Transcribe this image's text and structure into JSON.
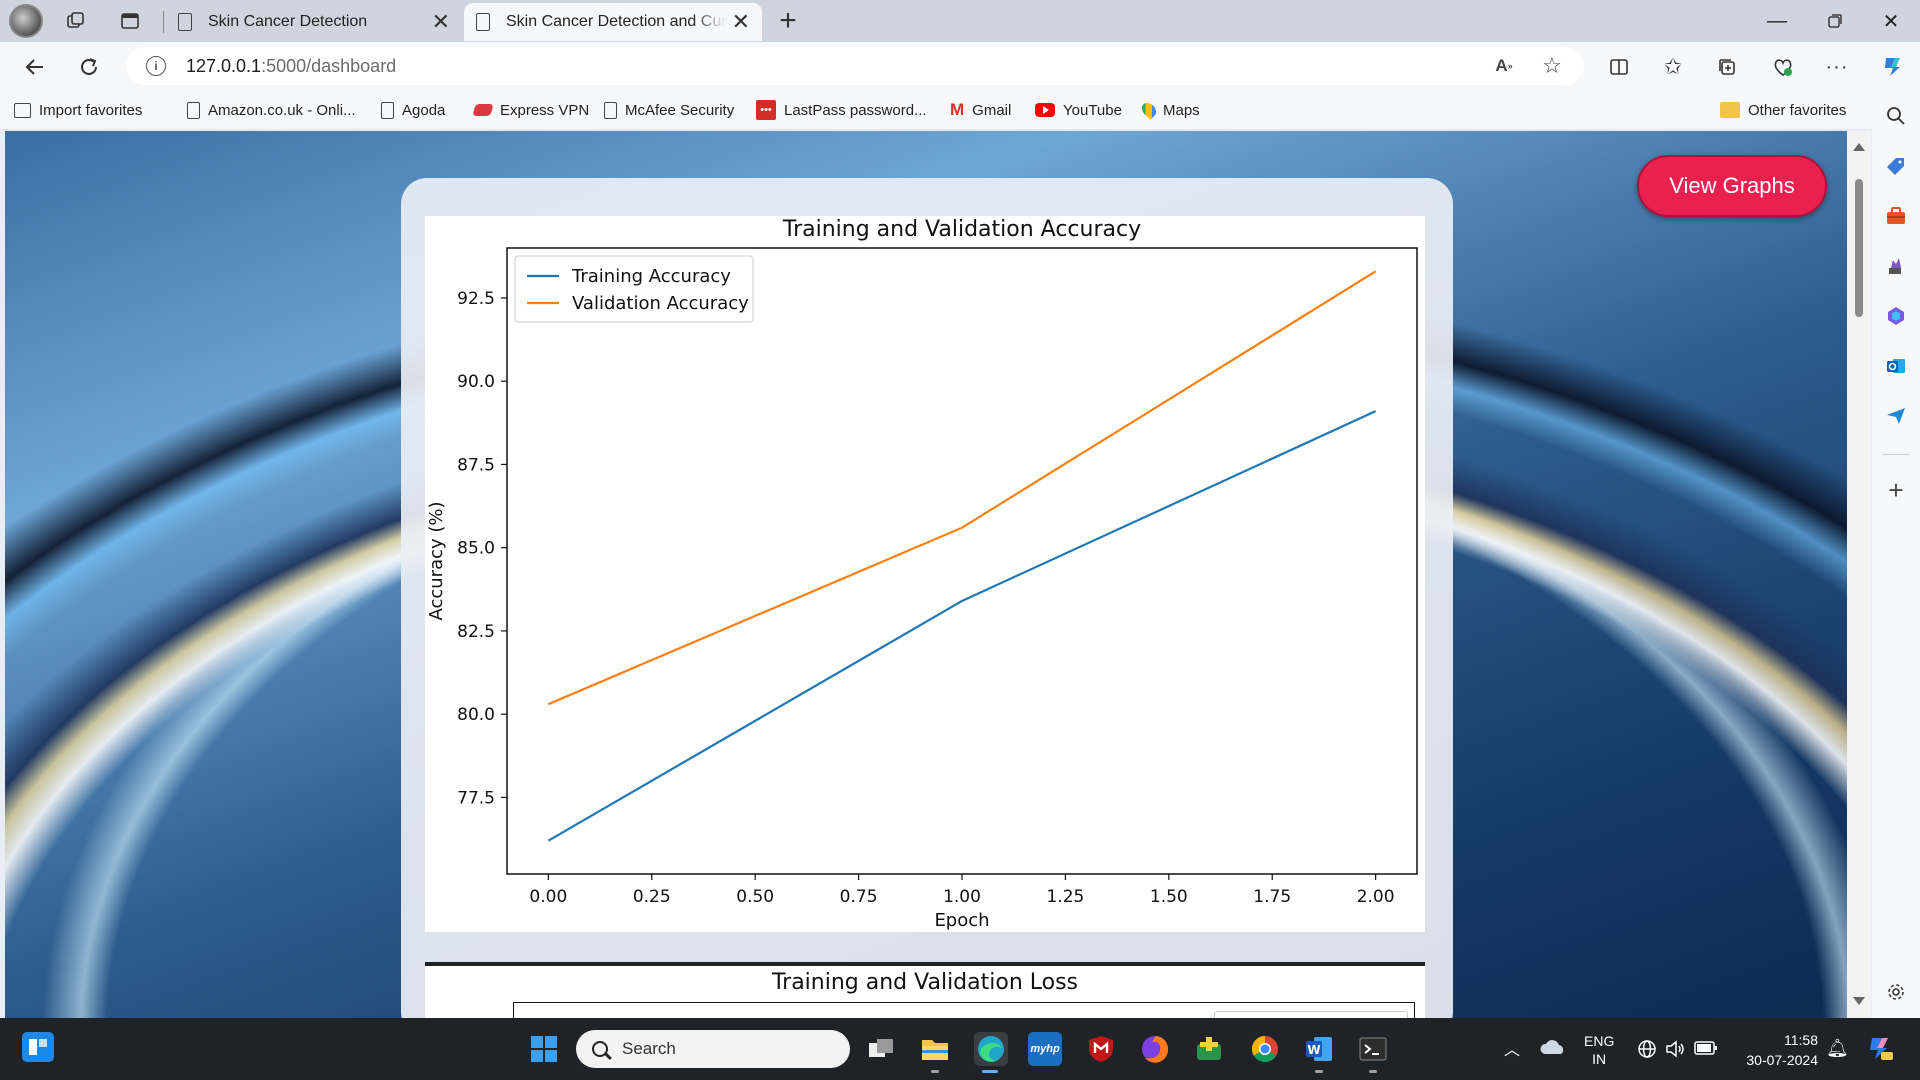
{
  "browser": {
    "tabs": [
      {
        "title": "Skin Cancer Detection",
        "active": false
      },
      {
        "title": "Skin Cancer Detection and Cure D",
        "active": true
      }
    ],
    "url_host": "127.0.0.1",
    "url_path": ":5000/dashboard",
    "favorites": [
      {
        "label": "Import favorites",
        "icon": "import-icon"
      },
      {
        "label": "Amazon.co.uk - Onli...",
        "icon": "page-icon"
      },
      {
        "label": "Agoda",
        "icon": "page-icon"
      },
      {
        "label": "Express VPN",
        "icon": "expressvpn-icon"
      },
      {
        "label": "McAfee Security",
        "icon": "page-icon"
      },
      {
        "label": "LastPass password...",
        "icon": "lastpass-icon"
      },
      {
        "label": "Gmail",
        "icon": "gmail-icon"
      },
      {
        "label": "YouTube",
        "icon": "youtube-icon"
      },
      {
        "label": "Maps",
        "icon": "maps-icon"
      }
    ],
    "other_favorites": "Other favorites"
  },
  "page": {
    "view_graphs_label": "View Graphs",
    "accent_color": "#e8214f",
    "loss_chart_title": "Training and Validation Loss"
  },
  "chart_data": {
    "type": "line",
    "title": "Training and Validation Accuracy",
    "xlabel": "Epoch",
    "ylabel": "Accuracy (%)",
    "x": [
      0,
      1,
      2
    ],
    "xlim": [
      -0.1,
      2.1
    ],
    "ylim": [
      75.2,
      94.0
    ],
    "xticks": [
      "0.00",
      "0.25",
      "0.50",
      "0.75",
      "1.00",
      "1.25",
      "1.50",
      "1.75",
      "2.00"
    ],
    "yticks": [
      "77.5",
      "80.0",
      "82.5",
      "85.0",
      "87.5",
      "90.0",
      "92.5"
    ],
    "legend_position": "top-left",
    "series": [
      {
        "name": "Training Accuracy",
        "color": "#1f77b4",
        "values": [
          76.2,
          83.4,
          89.1
        ]
      },
      {
        "name": "Validation Accuracy",
        "color": "#ff7f0e",
        "values": [
          80.3,
          85.6,
          93.3
        ]
      }
    ]
  },
  "taskbar": {
    "search_placeholder": "Search",
    "lang_line1": "ENG",
    "lang_line2": "IN",
    "time": "11:58",
    "date": "30-07-2024"
  }
}
